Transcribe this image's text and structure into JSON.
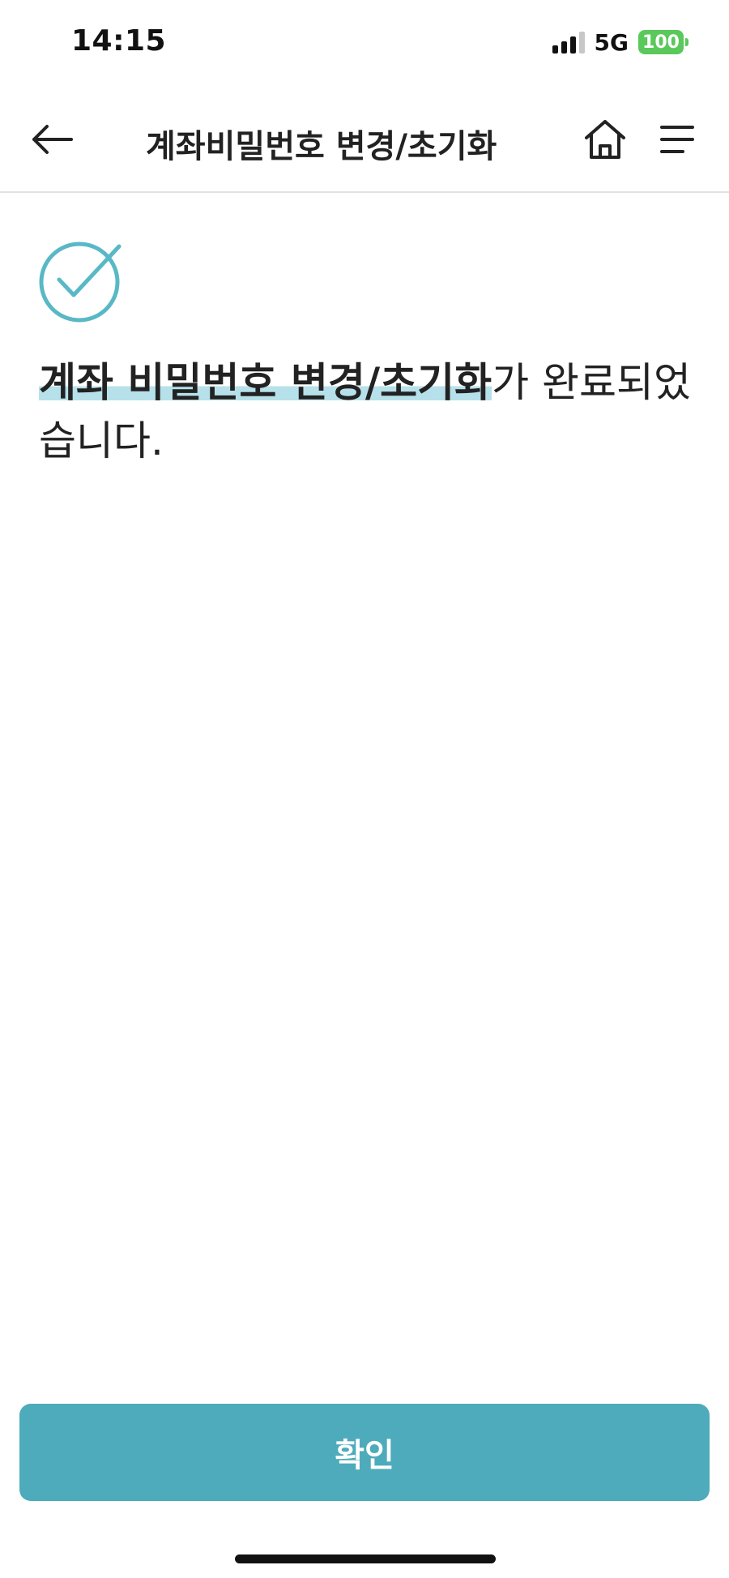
{
  "status_bar": {
    "time": "14:15",
    "network": "5G",
    "battery": "100"
  },
  "header": {
    "title": "계좌비밀번호 변경/초기화",
    "back_icon": "arrow-left-icon",
    "home_icon": "home-icon",
    "menu_icon": "menu-icon"
  },
  "result": {
    "icon": "check-circle-icon",
    "message_highlight": "계좌 비밀번호 변경/초기화",
    "message_rest": "가 완료되었습니다."
  },
  "footer": {
    "confirm_label": "확인"
  },
  "colors": {
    "accent": "#4eabbb",
    "highlight": "#b7e1ea",
    "battery": "#5ac85a"
  }
}
